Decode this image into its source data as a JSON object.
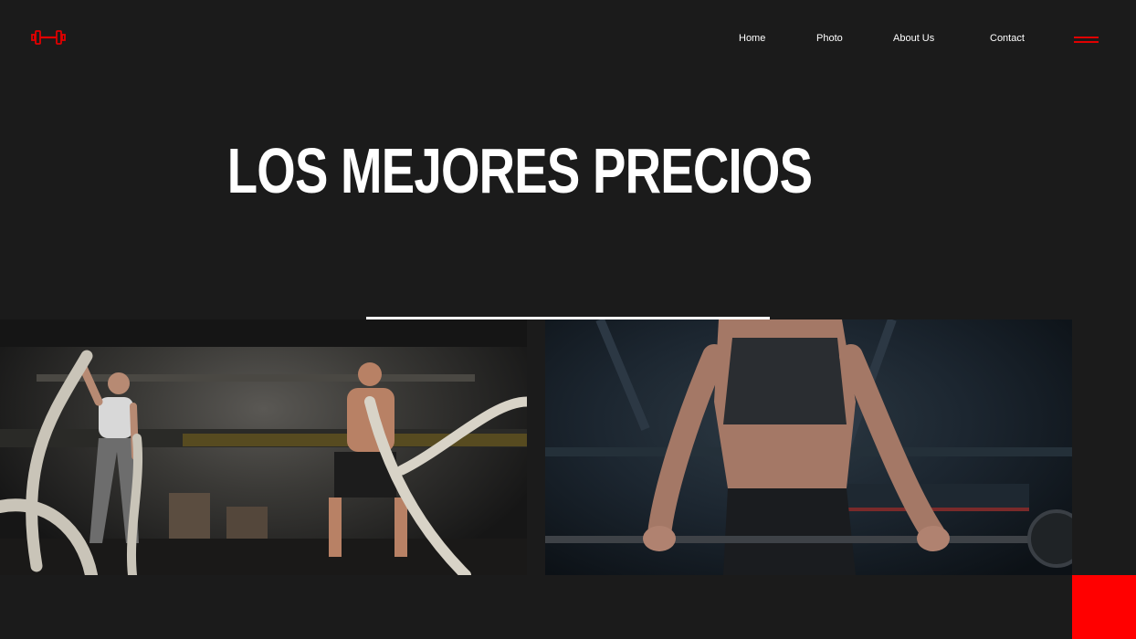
{
  "brand": {
    "logo_icon": "dumbbell-icon",
    "accent_color": "#e00000"
  },
  "nav": {
    "items": [
      {
        "label": "Home"
      },
      {
        "label": "Photo"
      },
      {
        "label": "About Us"
      },
      {
        "label": "Contact"
      }
    ],
    "menu_icon": "hamburger-menu-icon"
  },
  "hero": {
    "title": "LOS MEJORES PRECIOS"
  },
  "gallery": {
    "images": [
      {
        "description_icon": "battle-ropes-photo"
      },
      {
        "description_icon": "barbell-lift-photo"
      }
    ]
  },
  "colors": {
    "background": "#1b1b1b",
    "text": "#ffffff",
    "accent_block": "#ff0000"
  }
}
